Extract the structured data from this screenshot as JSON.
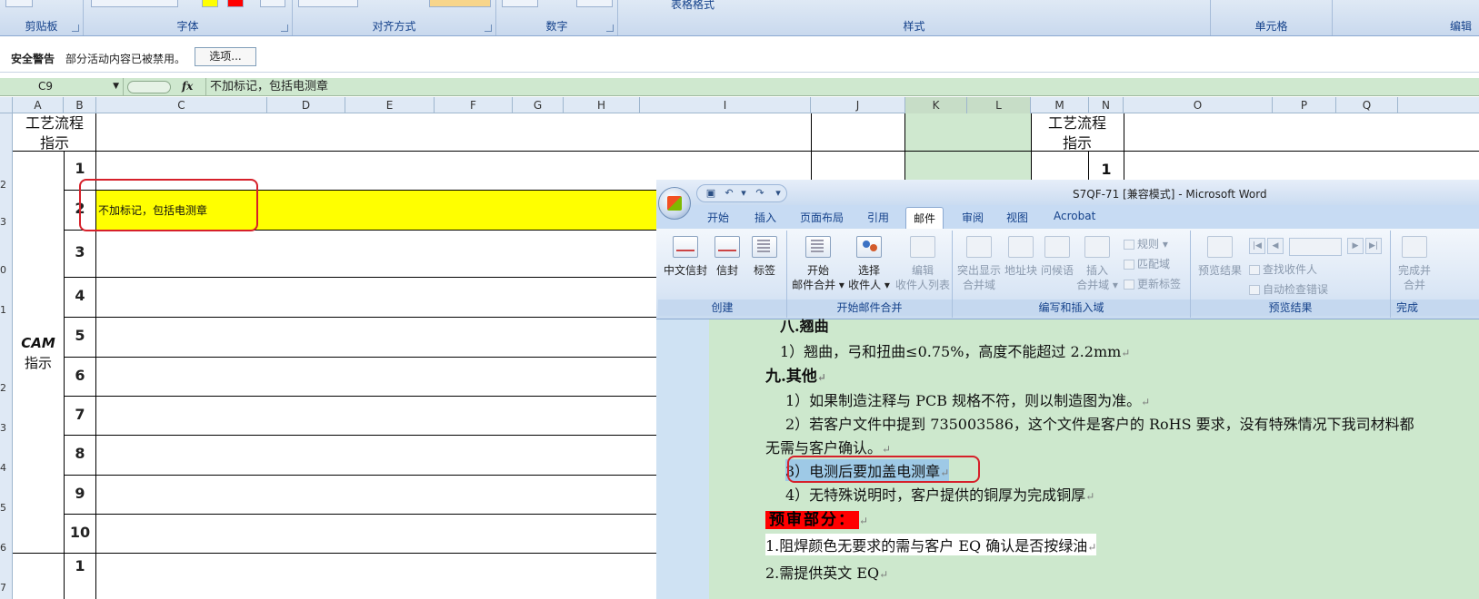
{
  "excel": {
    "ribbon_groups": [
      {
        "label": "剪贴板"
      },
      {
        "label": "字体"
      },
      {
        "label": "对齐方式"
      },
      {
        "label": "数字"
      },
      {
        "label": "样式"
      },
      {
        "label": "单元格"
      },
      {
        "label": "编辑"
      }
    ],
    "table_format_label": "表格格式",
    "security": {
      "title": "安全警告",
      "message": "部分活动内容已被禁用。",
      "options_button": "选项..."
    },
    "formula_bar": {
      "name_box": "C9",
      "fx": "fx",
      "formula": "不加标记，包括电测章"
    },
    "columns": [
      "A",
      "B",
      "C",
      "D",
      "E",
      "F",
      "G",
      "H",
      "I",
      "J",
      "K",
      "L",
      "M",
      "N",
      "O",
      "P",
      "Q"
    ],
    "row_headers": [
      "2",
      "3",
      "0",
      "1",
      "2",
      "3",
      "4",
      "5",
      "6",
      "7"
    ],
    "cells": {
      "a_header": "工艺流程指示",
      "m_header": "工艺流程指示",
      "cam_label_line1": "CAM",
      "cam_label_line2": "指示",
      "row_numbers": [
        "1",
        "2",
        "3",
        "4",
        "5",
        "6",
        "7",
        "8",
        "9",
        "10",
        "1"
      ],
      "n_row1": "1",
      "c_row2": "不加标记，包括电测章"
    }
  },
  "word": {
    "title": "S7QF-71 [兼容模式] - Microsoft Word",
    "tabs": [
      "开始",
      "插入",
      "页面布局",
      "引用",
      "邮件",
      "审阅",
      "视图",
      "Acrobat"
    ],
    "active_tab": "邮件",
    "groups": {
      "create": {
        "label": "创建",
        "buttons": [
          "中文信封",
          "信封",
          "标签"
        ]
      },
      "start_merge": {
        "label": "开始邮件合并",
        "buttons": [
          {
            "line1": "开始",
            "line2": "邮件合并"
          },
          {
            "line1": "选择",
            "line2": "收件人"
          },
          {
            "line1": "编辑",
            "line2": "收件人列表"
          }
        ]
      },
      "write_insert": {
        "label": "编写和插入域",
        "buttons": [
          {
            "line1": "突出显示",
            "line2": "合并域"
          },
          {
            "line1": "地址块",
            "line2": ""
          },
          {
            "line1": "问候语",
            "line2": ""
          },
          {
            "line1": "插入",
            "line2": "合并域"
          }
        ],
        "small": [
          "规则",
          "匹配域",
          "更新标签"
        ]
      },
      "preview": {
        "label": "预览结果",
        "button": "预览结果",
        "small": [
          "查找收件人",
          "自动检查错误"
        ]
      },
      "finish": {
        "label": "完成",
        "line1": "完成并",
        "line2": "合并"
      }
    },
    "document": {
      "lines": [
        "八.翘曲",
        "1）翘曲，弓和扭曲≤0.75%，高度不能超过 2.2mm",
        "九.其他",
        "1）如果制造注释与 PCB 规格不符，则以制造图为准。",
        "2）若客户文件中提到 735003586，这个文件是客户的 RoHS 要求，没有特殊情况下我司材料都",
        "无需与客户确认。",
        "3）电测后要加盖电测章",
        "4）无特殊说明时，客户提供的铜厚为完成铜厚",
        "预审部分：",
        "1.阻焊颜色无要求的需与客户 EQ 确认是否按绿油",
        "2.需提供英文 EQ"
      ]
    }
  },
  "colors": {
    "highlight_yellow": "#ffff00",
    "annotation_red": "#d6202a",
    "doc_green": "#cde8cd",
    "word_blue": "#c6d8ee"
  }
}
